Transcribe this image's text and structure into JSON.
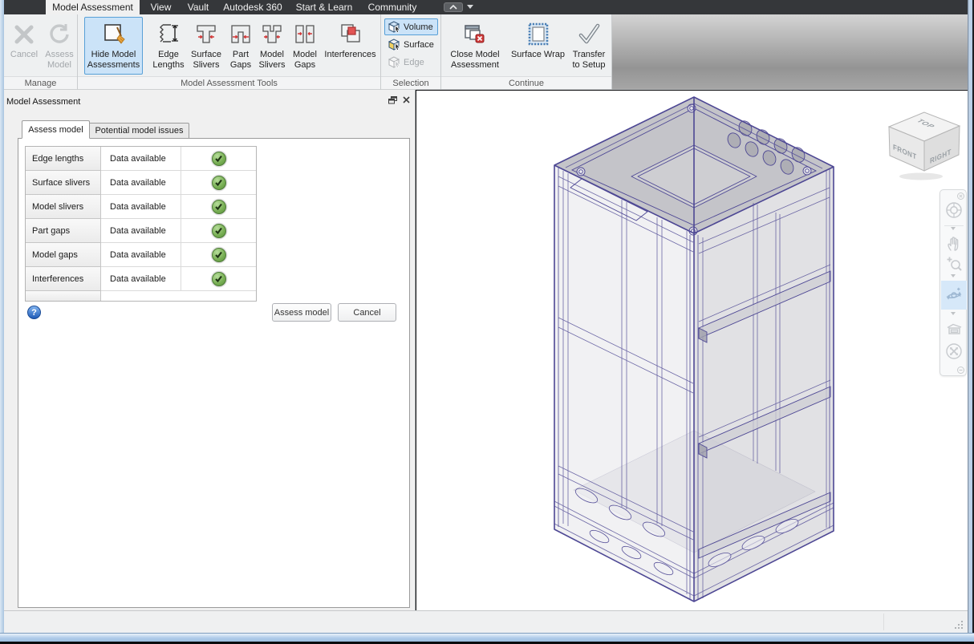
{
  "tabbar": {
    "tabs": [
      {
        "label": "Model Assessment",
        "active": true
      },
      {
        "label": "View"
      },
      {
        "label": "Vault"
      },
      {
        "label": "Autodesk 360"
      },
      {
        "label": "Start & Learn"
      },
      {
        "label": "Community"
      }
    ]
  },
  "ribbon": {
    "groups": [
      {
        "label": "Manage",
        "buttons": [
          {
            "label": "Cancel",
            "state": "disabled"
          },
          {
            "label": "Assess Model",
            "state": "disabled"
          }
        ]
      },
      {
        "label": "Model Assessment Tools",
        "buttons": [
          {
            "label": "Hide Model Assessments",
            "state": "active"
          },
          {
            "label": "Edge Lengths"
          },
          {
            "label": "Surface Slivers"
          },
          {
            "label": "Part Gaps"
          },
          {
            "label": "Model Slivers"
          },
          {
            "label": "Model Gaps"
          },
          {
            "label": "Interferences"
          }
        ]
      },
      {
        "label": "Selection",
        "buttons": [
          {
            "label": "Volume",
            "state": "active"
          },
          {
            "label": "Surface"
          },
          {
            "label": "Edge",
            "state": "disabled"
          }
        ]
      },
      {
        "label": "Continue",
        "buttons": [
          {
            "label": "Close Model Assessment"
          },
          {
            "label": "Surface Wrap"
          },
          {
            "label": "Transfer to Setup"
          }
        ]
      }
    ]
  },
  "panel": {
    "title": "Model Assessment",
    "tabs": [
      {
        "label": "Assess model",
        "active": true
      },
      {
        "label": "Potential model issues",
        "active": false
      }
    ],
    "table": {
      "rows": [
        {
          "name": "Edge lengths",
          "status": "Data available",
          "result": "ok"
        },
        {
          "name": "Surface slivers",
          "status": "Data available",
          "result": "ok"
        },
        {
          "name": "Model slivers",
          "status": "Data available",
          "result": "ok"
        },
        {
          "name": "Part gaps",
          "status": "Data available",
          "result": "ok"
        },
        {
          "name": "Model gaps",
          "status": "Data available",
          "result": "ok"
        },
        {
          "name": "Interferences",
          "status": "Data available",
          "result": "ok"
        }
      ]
    },
    "help_label": "?",
    "assess_button": "Assess model",
    "cancel_button": "Cancel"
  },
  "viewport": {
    "viewcube": {
      "top": "TOP",
      "front": "FRONT",
      "right": "RIGHT"
    },
    "navbar_icons": [
      "navigation-wheel",
      "pan",
      "zoom",
      "orbit",
      "look-at",
      "zoom-extents"
    ]
  },
  "colors": {
    "highlight_fill": "#cbe3f8",
    "highlight_border": "#58a0d7",
    "status_green": "#76ad52",
    "interference_red": "#e05252",
    "model_edge_purple": "#4d4794",
    "tabbar_dark": "#35373a"
  }
}
